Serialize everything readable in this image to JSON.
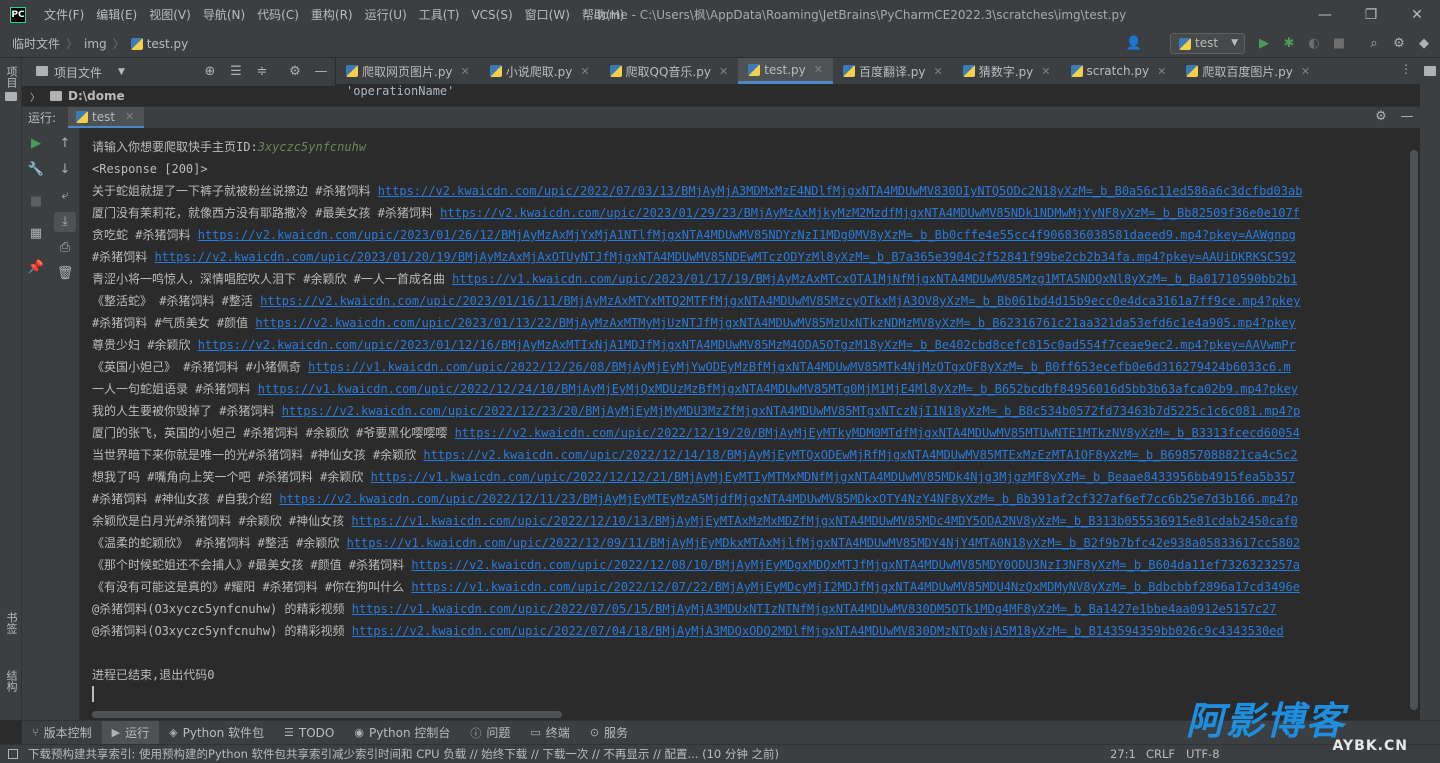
{
  "title_bar": {
    "logo": "PC",
    "menu": [
      "文件(F)",
      "编辑(E)",
      "视图(V)",
      "导航(N)",
      "代码(C)",
      "重构(R)",
      "运行(U)",
      "工具(T)",
      "VCS(S)",
      "窗口(W)",
      "帮助(H)"
    ],
    "window_title": "dome - C:\\Users\\枫\\AppData\\Roaming\\JetBrains\\PyCharmCE2022.3\\scratches\\img\\test.py"
  },
  "nav_bar": {
    "breadcrumbs": [
      "临时文件",
      "img",
      "test.py"
    ],
    "run_config": "test"
  },
  "left_stripe": {
    "project_label": "项目",
    "bookmarks_label": "书签",
    "structure_label": "结构"
  },
  "project_panel": {
    "title": "项目文件",
    "root_item": "D:\\dome"
  },
  "editor": {
    "tabs": [
      {
        "label": "爬取网页图片.py",
        "active": false
      },
      {
        "label": "小说爬取.py",
        "active": false
      },
      {
        "label": "爬取QQ音乐.py",
        "active": false
      },
      {
        "label": "test.py",
        "active": true
      },
      {
        "label": "百度翻译.py",
        "active": false
      },
      {
        "label": "猜数字.py",
        "active": false
      },
      {
        "label": "scratch.py",
        "active": false
      },
      {
        "label": "爬取百度图片.py",
        "active": false
      }
    ],
    "visible_code": "'operationName'"
  },
  "run_window": {
    "label": "运行:",
    "tab_label": "test",
    "prompt": "请输入你想要爬取快手主页ID:",
    "prompt_input": "3xyczc5ynfcnuhw",
    "response": "<Response [200]>",
    "lines": [
      {
        "text": "关于蛇姐就提了一下裤子就被粉丝说擦边 #杀猪饲料 ",
        "url": "https://v2.kwaicdn.com/upic/2022/07/03/13/BMjAyMjA3MDMxMzE4NDlfMjgxNTA4MDUwMV830DIyNTQ5ODc2N18yXzM=_b_B0a56c11ed586a6c3dcfbd03ab"
      },
      {
        "text": "厦门没有茉莉花，就像西方没有耶路撒冷 #最美女孩 #杀猪饲料 ",
        "url": "https://v2.kwaicdn.com/upic/2023/01/29/23/BMjAyMzAxMjkyMzM2MzdfMjgxNTA4MDUwMV85NDk1NDMwMjYyNF8yXzM=_b_Bb82509f36e0e107f"
      },
      {
        "text": "贪吃蛇 #杀猪饲料 ",
        "url": "https://v2.kwaicdn.com/upic/2023/01/26/12/BMjAyMzAxMjYxMjA1NTlfMjgxNTA4MDUwMV85NDYzNzI1MDg0MV8yXzM=_b_Bb0cffe4e55cc4f906836038581daeed9.mp4?pkey=AAWgnpg"
      },
      {
        "text": "#杀猪饲料 ",
        "url": "https://v2.kwaicdn.com/upic/2023/01/20/19/BMjAyMzAxMjAxOTUyNTJfMjgxNTA4MDUwMV85NDEwMTczODYzMl8yXzM=_b_B7a365e3904c2f52841f99be2cb2b34fa.mp4?pkey=AAUiDKRKSC592"
      },
      {
        "text": "青涩小将一鸣惊人，深情唱腔吹人泪下 #余颖欣 #一人一首成名曲 ",
        "url": "https://v1.kwaicdn.com/upic/2023/01/17/19/BMjAyMzAxMTcxOTA1MjNfMjgxNTA4MDUwMV85Mzg1MTA5NDQxNl8yXzM=_b_Ba01710590bb2b1"
      },
      {
        "text": "《整活蛇》 #杀猪饲料 #整活 ",
        "url": "https://v2.kwaicdn.com/upic/2023/01/16/11/BMjAyMzAxMTYxMTQ2MTFfMjgxNTA4MDUwMV85MzcyOTkxMjA3OV8yXzM=_b_Bb061bd4d15b9ecc0e4dca3161a7ff9ce.mp4?pkey"
      },
      {
        "text": "#杀猪饲料 #气质美女 #颜值 ",
        "url": "https://v2.kwaicdn.com/upic/2023/01/13/22/BMjAyMzAxMTMyMjUzNTJfMjgxNTA4MDUwMV85MzUxNTkzNDMzMV8yXzM=_b_B62316761c21aa321da53efd6c1e4a905.mp4?pkey"
      },
      {
        "text": "尊贵少妇 #余颖欣 ",
        "url": "https://v2.kwaicdn.com/upic/2023/01/12/16/BMjAyMzAxMTIxNjA1MDJfMjgxNTA4MDUwMV85MzM4ODA5OTgzM18yXzM=_b_Be402cbd8cefc815c0ad554f7ceae9ec2.mp4?pkey=AAVwmPr"
      },
      {
        "text": "《英国小妲己》 #杀猪饲料 #小猪佩奇 ",
        "url": "https://v1.kwaicdn.com/upic/2022/12/26/08/BMjAyMjEyMjYwODEyMzBfMjgxNTA4MDUwMV85MTk4NjMzOTgxOF8yXzM=_b_B0ff653ecefb0e6d316279424b6033c6.m"
      },
      {
        "text": "一人一句蛇姐语录 #杀猪饲料 ",
        "url": "https://v1.kwaicdn.com/upic/2022/12/24/10/BMjAyMjEyMjQxMDUzMzBfMjgxNTA4MDUwMV85MTg0MjM1MjE4Ml8yXzM=_b_B652bcdbf84956016d5bb3b63afca02b9.mp4?pkey"
      },
      {
        "text": "我的人生要被你毁掉了 #杀猪饲料 ",
        "url": "https://v2.kwaicdn.com/upic/2022/12/23/20/BMjAyMjEyMjMyMDU3MzZfMjgxNTA4MDUwMV85MTgxNTczNjI1N18yXzM=_b_B8c534b0572fd73463b7d5225c1c6c081.mp4?p"
      },
      {
        "text": "厦门的张飞，英国的小妲己 #杀猪饲料 #余颖欣 #爷要黑化嘤嘤嘤 ",
        "url": "https://v2.kwaicdn.com/upic/2022/12/19/20/BMjAyMjEyMTkyMDM0MTdfMjgxNTA4MDUwMV85MTUwNTE1MTkzNV8yXzM=_b_B3313fcecd60054"
      },
      {
        "text": "当世界暗下来你就是唯一的光#杀猪饲料 #神仙女孩 #余颖欣 ",
        "url": "https://v2.kwaicdn.com/upic/2022/12/14/18/BMjAyMjEyMTQxODEwMjRfMjgxNTA4MDUwMV85MTExMzEzMTA1OF8yXzM=_b_B69857088821ca4c5c2"
      },
      {
        "text": "想我了吗 #嘴角向上笑一个吧 #杀猪饲料 #余颖欣 ",
        "url": "https://v1.kwaicdn.com/upic/2022/12/12/21/BMjAyMjEyMTIyMTMxMDNfMjgxNTA4MDUwMV85MDk4Njg3MjgzMF8yXzM=_b_Beaae8433956bb4915fea5b357"
      },
      {
        "text": "#杀猪饲料 #神仙女孩 #自我介绍 ",
        "url": "https://v2.kwaicdn.com/upic/2022/12/11/23/BMjAyMjEyMTEyMzA5MjdfMjgxNTA4MDUwMV85MDkxOTY4NzY4NF8yXzM=_b_Bb391af2cf327af6ef7cc6b25e7d3b166.mp4?p"
      },
      {
        "text": "余颖欣是白月光#杀猪饲料 #余颖欣 #神仙女孩 ",
        "url": "https://v1.kwaicdn.com/upic/2022/12/10/13/BMjAyMjEyMTAxMzMxMDZfMjgxNTA4MDUwMV85MDc4MDY5ODA2NV8yXzM=_b_B313b055536915e81cdab2450caf0"
      },
      {
        "text": "《温柔的蛇颖欣》 #杀猪饲料 #整活 #余颖欣 ",
        "url": "https://v1.kwaicdn.com/upic/2022/12/09/11/BMjAyMjEyMDkxMTAxMjlfMjgxNTA4MDUwMV85MDY4NjY4MTA0N18yXzM=_b_B2f9b7bfc42e938a05833617cc5802"
      },
      {
        "text": "《那个时候蛇姐还不会捕人》#最美女孩 #颜值 #杀猪饲料 ",
        "url": "https://v2.kwaicdn.com/upic/2022/12/08/10/BMjAyMjEyMDgxMDQxMTJfMjgxNTA4MDUwMV85MDY0ODU3NzI3NF8yXzM=_b_B604da11ef7326323257a"
      },
      {
        "text": "《有没有可能这是真的》#耀阳 #杀猪饲料 #你在狗叫什么 ",
        "url": "https://v1.kwaicdn.com/upic/2022/12/07/22/BMjAyMjEyMDcyMjI2MDJfMjgxNTA4MDUwMV85MDU4NzQxMDMyNV8yXzM=_b_Bdbcbbf2896a17cd3496e"
      },
      {
        "text": " @杀猪饲料(O3xyczc5ynfcnuhw) 的精彩视频 ",
        "url": "https://v1.kwaicdn.com/upic/2022/07/05/15/BMjAyMjA3MDUxNTIzNTNfMjgxNTA4MDUwMV830DM5OTk1MDg4MF8yXzM=_b_Ba1427e1bbe4aa0912e5157c27"
      },
      {
        "text": " @杀猪饲料(O3xyczc5ynfcnuhw) 的精彩视频 ",
        "url": "https://v2.kwaicdn.com/upic/2022/07/04/18/BMjAyMjA3MDQxODQ2MDlfMjgxNTA4MDUwMV830DMzNTQxNjA5M18yXzM=_b_B143594359bb026c9c4343530ed"
      }
    ],
    "exit_message": "进程已结束,退出代码0"
  },
  "bottom_tabs": [
    {
      "icon": "版本控制-icon",
      "label": "版本控制",
      "active": false
    },
    {
      "icon": "run-icon",
      "label": "运行",
      "active": true
    },
    {
      "icon": "python-packages-icon",
      "label": "Python 软件包",
      "active": false
    },
    {
      "icon": "todo-icon",
      "label": "TODO",
      "active": false
    },
    {
      "icon": "python-console-icon",
      "label": "Python 控制台",
      "active": false
    },
    {
      "icon": "problems-icon",
      "label": "问题",
      "active": false
    },
    {
      "icon": "terminal-icon",
      "label": "终端",
      "active": false
    },
    {
      "icon": "services-icon",
      "label": "服务",
      "active": false
    }
  ],
  "status_bar": {
    "message": "下载预构建共享索引: 使用预构建的Python 软件包共享索引减少索引时间和 CPU 负载 // 始终下载 // 下载一次 // 不再显示 // 配置... (10 分钟 之前)",
    "position": "27:1",
    "line_sep": "CRLF",
    "encoding": "UTF-8"
  },
  "watermark": {
    "text": "阿影博客",
    "sub": "AYBK.CN"
  },
  "colors": {
    "background": "#2b2b2b",
    "panel": "#3c3f41",
    "link": "#287bde",
    "accent": "#4a88c7",
    "run_green": "#499c54"
  }
}
